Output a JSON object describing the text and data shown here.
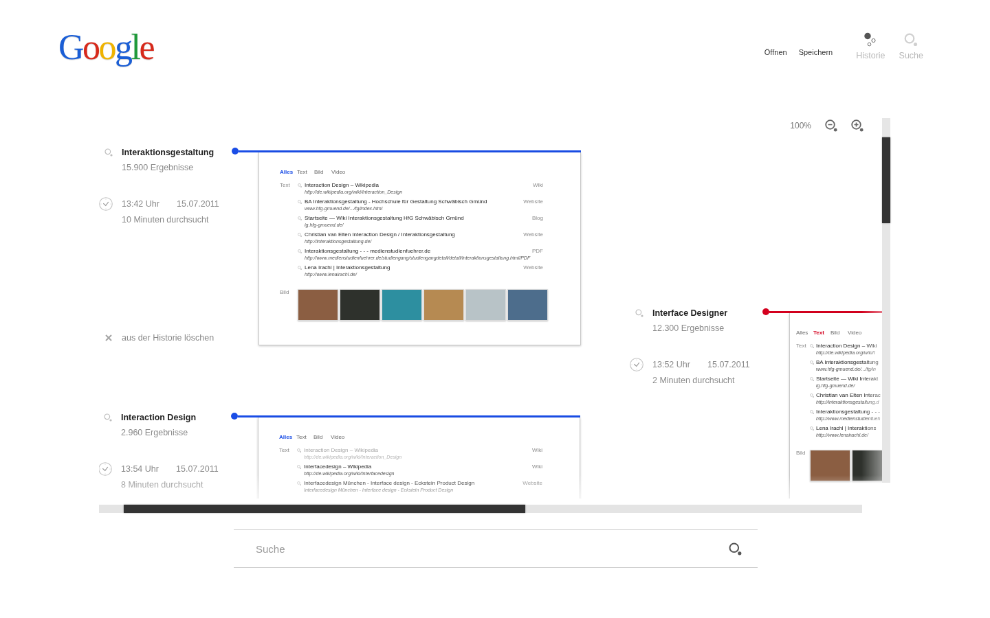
{
  "header": {
    "logo": "Google",
    "actions": [
      "Öffnen",
      "Speichern"
    ],
    "views": [
      {
        "label": "Historie",
        "selected": true
      },
      {
        "label": "Suche",
        "selected": false
      }
    ]
  },
  "zoom": {
    "reading": "100%"
  },
  "sessions": [
    {
      "query": "Interaktionsgestaltung",
      "results_count": "15.900 Ergebnisse",
      "time": "13:42 Uhr",
      "date": "15.07.2011",
      "duration": "10 Minuten durchsucht",
      "delete_label": "aus der Historie löschen",
      "color": "#1a4de6",
      "preview": {
        "tabs": [
          {
            "label": "Alles",
            "selected": true
          },
          {
            "label": "Text",
            "selected": false
          },
          {
            "label": "Bild",
            "selected": false
          },
          {
            "label": "Video",
            "selected": false
          }
        ],
        "sections": [
          {
            "kind": "text",
            "label": "Text",
            "results": [
              {
                "title": "Interaction Design – Wikipedia",
                "url": "http://de.wikipedia.org/wiki/Interaction_Design",
                "category": "Wiki",
                "visited": false
              },
              {
                "title": "BA Interaktionsgestaltung - Hochschule für Gestaltung Schwäbisch Gmünd",
                "url": "www.hfg-gmuend.de/.../fg/index.html",
                "category": "Website",
                "visited": false
              },
              {
                "title": "Startseite — Wiki Interaktionsgestaltung HfG Schwäbisch Gmünd",
                "url": "ig.hfg-gmuend.de/",
                "category": "Blog",
                "visited": false
              },
              {
                "title": "Christian van Elten Interaction Design / Interaktionsgestaltung",
                "url": "http://interaktionsgestaltung.de/",
                "category": "Website",
                "visited": false
              },
              {
                "title": "Interaktionsgestaltung - - - medienstudienfuehrer.de",
                "url": "http://www.medienstudienfuehrer.de/studiengang/studiengangdetail/detail/interaktionsgestaltung.html/PDF",
                "category": "PDF",
                "visited": false
              },
              {
                "title": "Lena Irachl | Interaktionsgestaltung",
                "url": "http://www.lenairachl.de/",
                "category": "Website",
                "visited": false
              }
            ]
          },
          {
            "kind": "images",
            "label": "Bild",
            "images": [
              {
                "kind": "photo"
              },
              {
                "kind": "photo"
              },
              {
                "kind": "photo"
              },
              {
                "kind": "photo"
              },
              {
                "kind": "photo"
              },
              {
                "kind": "photo"
              }
            ]
          }
        ]
      }
    },
    {
      "query": "Interface Designer",
      "results_count": "12.300 Ergebnisse",
      "time": "13:52 Uhr",
      "date": "15.07.2011",
      "duration": "2 Minuten durchsucht",
      "color": "#d4001e",
      "preview": {
        "tabs": [
          {
            "label": "Alles",
            "selected": false
          },
          {
            "label": "Text",
            "selected": true
          },
          {
            "label": "Bild",
            "selected": false
          },
          {
            "label": "Video",
            "selected": false
          }
        ],
        "sections": [
          {
            "kind": "text",
            "label": "Text",
            "results": [
              {
                "title": "Interaction Design – Wiki",
                "url": "http://de.wikipedia.org/wiki/I",
                "visited": false
              },
              {
                "title": "BA Interaktionsgestaltung",
                "url": "www.hfg-gmuend.de/.../fg/in",
                "visited": false
              },
              {
                "title": "Startseite — Wiki Interakt",
                "url": "ig.hfg-gmuend.de/",
                "visited": false
              },
              {
                "title": "Christian van Elten Interac",
                "url": "http://interaktionsgestaltung.d",
                "visited": false
              },
              {
                "title": "Interaktionsgestaltung - - -",
                "url": "http://www.medienstudienfueh",
                "visited": false
              },
              {
                "title": "Lena Irachl | Interaktions",
                "url": "http://www.lenairachl.de/",
                "visited": false
              }
            ]
          },
          {
            "kind": "images",
            "label": "Bild",
            "images": [
              {
                "kind": "photo"
              },
              {
                "kind": "photo"
              }
            ]
          }
        ]
      }
    },
    {
      "query": "Interaction Design",
      "results_count": "2.960 Ergebnisse",
      "time": "13:54 Uhr",
      "date": "15.07.2011",
      "duration": "8 Minuten durchsucht",
      "color": "#1a4de6",
      "preview": {
        "tabs": [
          {
            "label": "Alles",
            "selected": true
          },
          {
            "label": "Text",
            "selected": false
          },
          {
            "label": "Bild",
            "selected": false
          },
          {
            "label": "Video",
            "selected": false
          }
        ],
        "sections": [
          {
            "kind": "text",
            "label": "Text",
            "results": [
              {
                "title": "Interaction Design – Wikipedia",
                "url": "http://de.wikipedia.org/wiki/Interaction_Design",
                "category": "Wiki",
                "visited": true
              },
              {
                "title": "Interfacedesign – Wikipedia",
                "url": "http://de.wikipedia.org/wiki/Interfacedesign",
                "category": "Wiki",
                "visited": false
              },
              {
                "title": "Interfacedesign München - Interface design - Eckstein Product Design",
                "url": "Interfacedesign München - Interface design - Eckstein Product Design",
                "category": "Website",
                "visited": false
              }
            ]
          }
        ]
      }
    }
  ],
  "search": {
    "placeholder": "Suche"
  }
}
